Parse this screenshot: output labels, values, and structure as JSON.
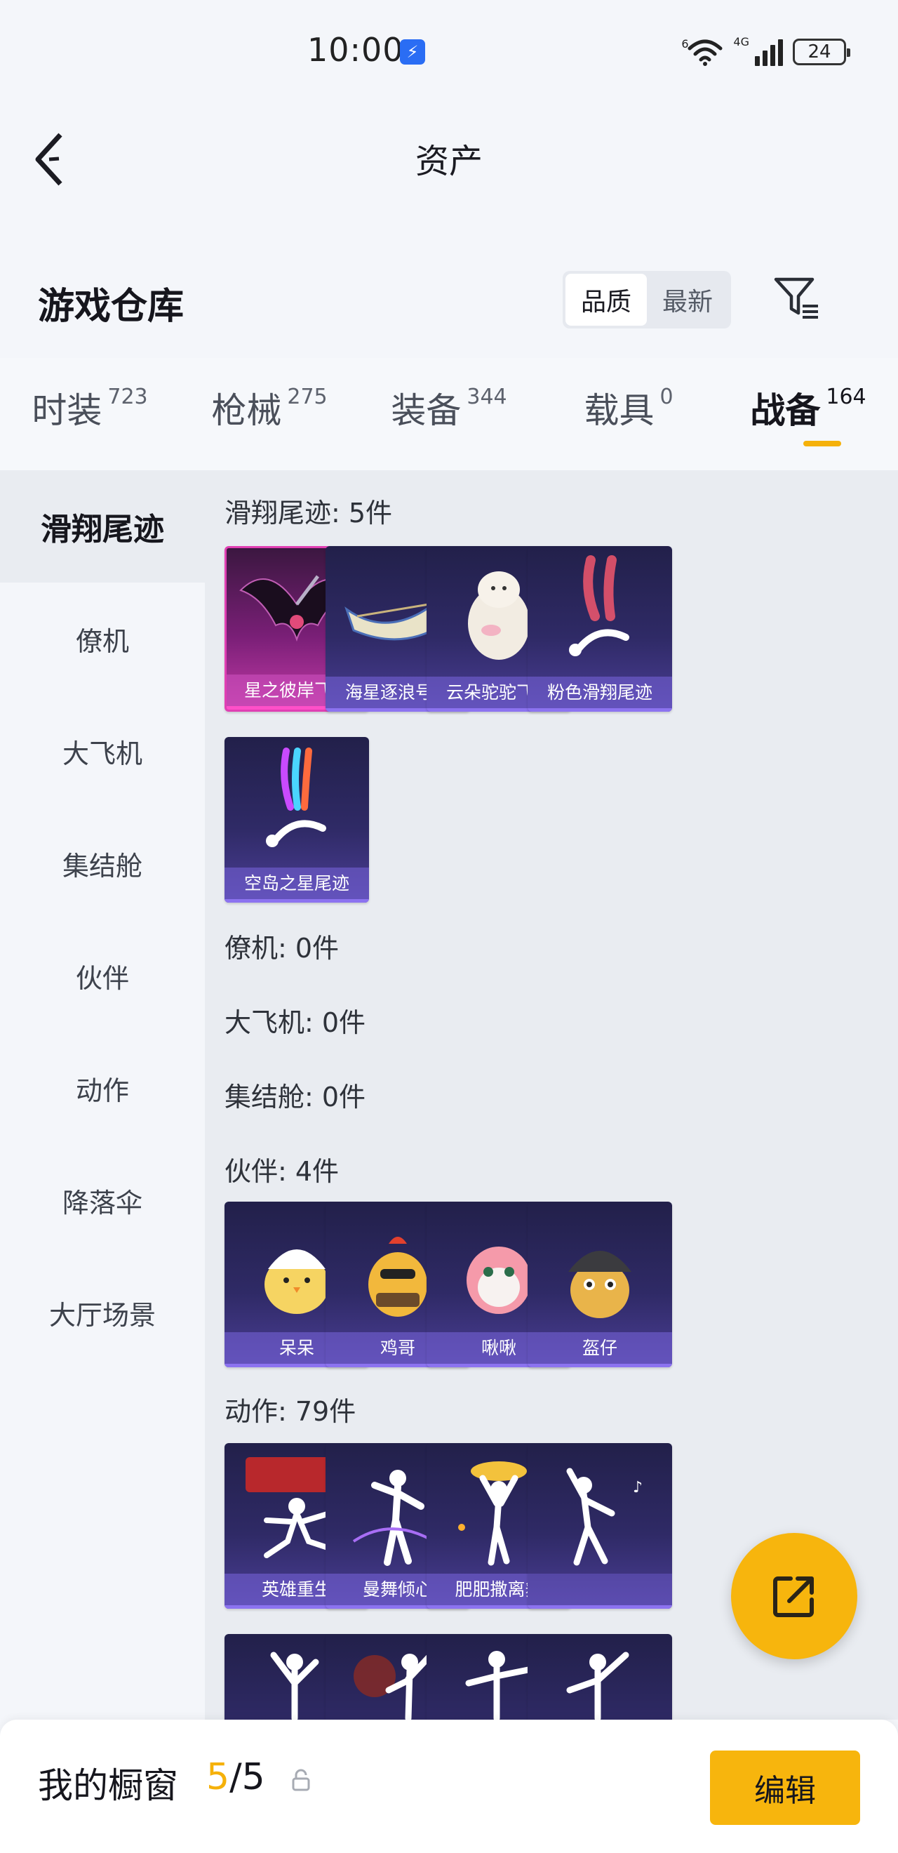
{
  "status_bar": {
    "time": "10:00",
    "wifi_label": "6",
    "signal_label": "4G",
    "battery": "24"
  },
  "header": {
    "title": "资产"
  },
  "warehouse": {
    "title": "游戏仓库",
    "sort_options": [
      "品质",
      "最新"
    ],
    "active_sort": "品质"
  },
  "tabs": [
    {
      "label": "时装",
      "count": "723"
    },
    {
      "label": "枪械",
      "count": "275"
    },
    {
      "label": "装备",
      "count": "344"
    },
    {
      "label": "载具",
      "count": "0"
    },
    {
      "label": "战备",
      "count": "164"
    }
  ],
  "active_tab": "战备",
  "categories": [
    "滑翔尾迹",
    "僚机",
    "大飞机",
    "集结舱",
    "伙伴",
    "动作",
    "降落伞",
    "大厅场景"
  ],
  "active_category": "滑翔尾迹",
  "groups": {
    "glide": {
      "title": "滑翔尾迹: 5件",
      "items": [
        "星之彼岸飞…",
        "海星逐浪号…",
        "云朵驼驼飞…",
        "粉色滑翔尾迹",
        "空岛之星尾迹"
      ]
    },
    "wingman": {
      "title": "僚机: 0件"
    },
    "plane": {
      "title": "大飞机: 0件"
    },
    "pod": {
      "title": "集结舱: 0件"
    },
    "partner": {
      "title": "伙伴: 4件",
      "items": [
        "呆呆",
        "鸡哥",
        "啾啾",
        "盔仔"
      ]
    },
    "emote": {
      "title": "动作: 79件",
      "items": [
        "英雄重生",
        "曼舞倾心",
        "肥肥撒离舞",
        ""
      ]
    }
  },
  "bottom": {
    "showcase_label": "我的橱窗",
    "showcase_current": "5",
    "showcase_sep": "/",
    "showcase_total": "5",
    "edit_label": "编辑"
  },
  "colors": {
    "accent": "#f7b50d",
    "card_blue": "#2f2a66",
    "card_pink": "#c23aa6"
  }
}
